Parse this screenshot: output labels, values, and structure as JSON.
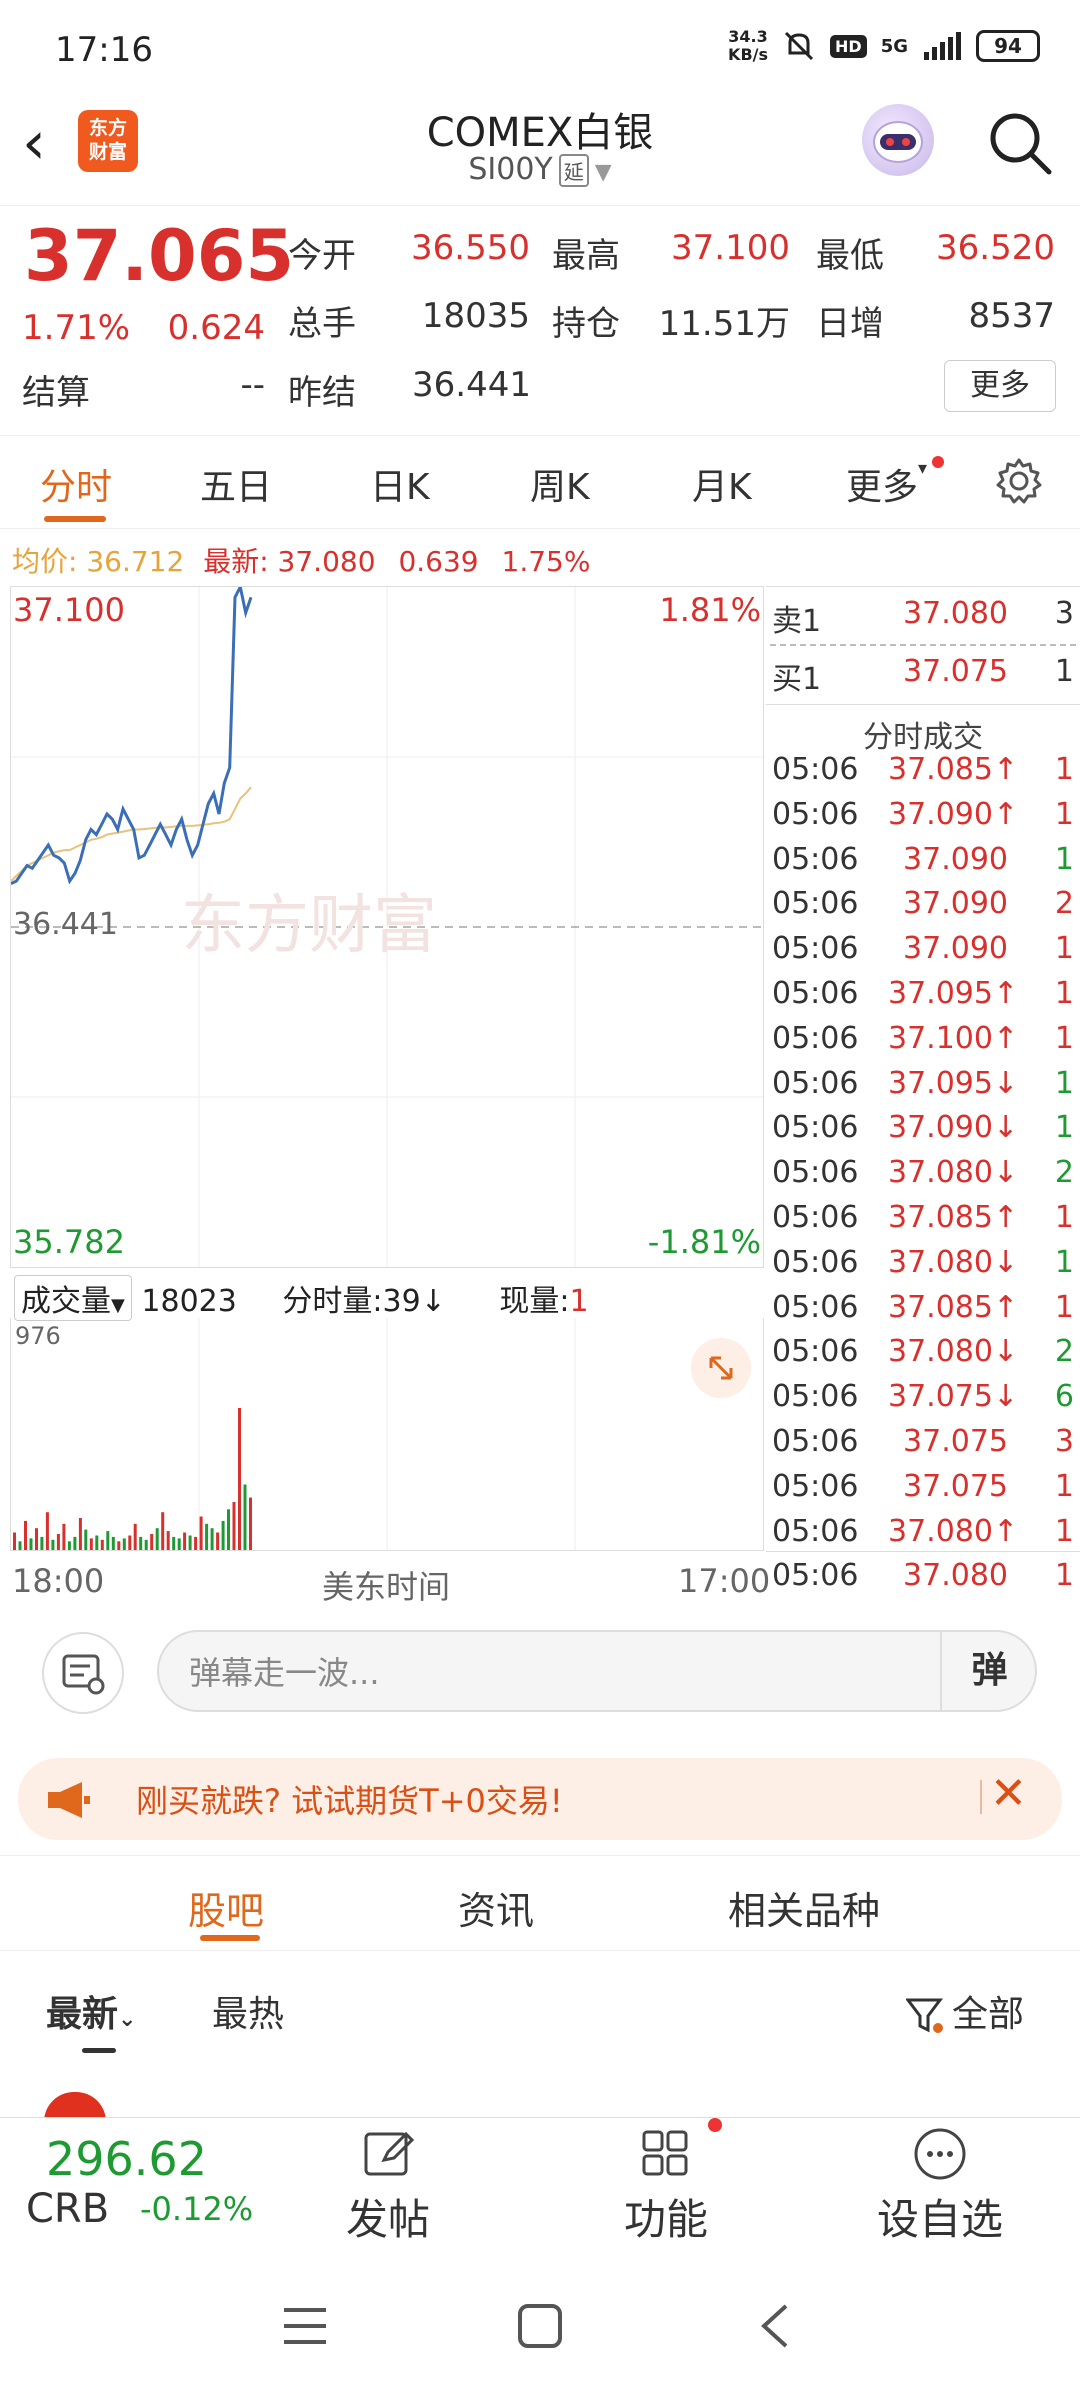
{
  "status": {
    "time": "17:16",
    "net_speed": "34.3",
    "net_unit": "KB/s",
    "hd": "HD",
    "signal": "5G",
    "battery": "94"
  },
  "nav": {
    "title": "COMEX白银",
    "code": "SI00Y",
    "delay_badge": "延"
  },
  "quote": {
    "price": "37.065",
    "change_pct": "1.71%",
    "change": "0.624",
    "settle_label": "结算",
    "settle_value": "--",
    "open_label": "今开",
    "open_value": "36.550",
    "high_label": "最高",
    "high_value": "37.100",
    "low_label": "最低",
    "low_value": "36.520",
    "vol_label": "总手",
    "vol_value": "18035",
    "oi_label": "持仓",
    "oi_value": "11.51万",
    "dayinc_label": "日增",
    "dayinc_value": "8537",
    "prev_label": "昨结",
    "prev_value": "36.441",
    "more_label": "更多"
  },
  "tabs": [
    "分时",
    "五日",
    "日K",
    "周K",
    "月K",
    "更多"
  ],
  "avg": {
    "avg_label": "均价: 36.712",
    "latest_label": "最新: 37.080",
    "chg": "0.639",
    "pct": "1.75%"
  },
  "chart_data": {
    "type": "line",
    "y_top": "37.100",
    "y_bottom": "35.782",
    "pct_top": "1.81%",
    "pct_bottom": "-1.81%",
    "prev_close": "36.441",
    "ylim": [
      35.782,
      37.1
    ],
    "xlabel_left": "18:00",
    "xlabel_mid": "美东时间",
    "xlabel_right": "17:00",
    "price": [
      36.525,
      36.53,
      36.545,
      36.56,
      36.555,
      36.57,
      36.585,
      36.6,
      36.58,
      36.575,
      36.565,
      36.53,
      36.545,
      36.57,
      36.61,
      36.63,
      36.62,
      36.64,
      36.66,
      36.65,
      36.63,
      36.67,
      36.65,
      36.63,
      36.575,
      36.58,
      36.6,
      36.62,
      36.64,
      36.62,
      36.6,
      36.63,
      36.65,
      36.61,
      36.58,
      36.6,
      36.64,
      36.68,
      36.7,
      36.66,
      36.72,
      36.75,
      37.08,
      37.1,
      37.05,
      37.08
    ],
    "average": [
      36.53,
      36.54,
      36.55,
      36.56,
      36.565,
      36.57,
      36.575,
      36.58,
      36.585,
      36.588,
      36.59,
      36.59,
      36.595,
      36.6,
      36.605,
      36.61,
      36.612,
      36.615,
      36.62,
      36.622,
      36.624,
      36.626,
      36.628,
      36.63,
      36.63,
      36.631,
      36.632,
      36.633,
      36.634,
      36.634,
      36.635,
      36.636,
      36.637,
      36.637,
      36.637,
      36.638,
      36.639,
      36.64,
      36.642,
      36.643,
      36.645,
      36.65,
      36.67,
      36.69,
      36.7,
      36.712
    ],
    "volume_max_label": "976",
    "volume": [
      120,
      60,
      200,
      80,
      150,
      90,
      260,
      70,
      110,
      180,
      60,
      90,
      220,
      140,
      80,
      100,
      70,
      130,
      90,
      60,
      80,
      100,
      180,
      90,
      70,
      110,
      150,
      260,
      130,
      90,
      80,
      120,
      100,
      90,
      230,
      180,
      150,
      120,
      200,
      280,
      330,
      976,
      450,
      360
    ],
    "volume_colors": [
      "r",
      "g",
      "r",
      "g",
      "r",
      "g",
      "r",
      "g",
      "r",
      "r",
      "g",
      "g",
      "r",
      "g",
      "r",
      "g",
      "r",
      "g",
      "g",
      "r",
      "g",
      "r",
      "r",
      "g",
      "g",
      "r",
      "g",
      "r",
      "r",
      "g",
      "g",
      "r",
      "g",
      "r",
      "r",
      "g",
      "g",
      "r",
      "g",
      "g",
      "r",
      "r",
      "g",
      "r"
    ]
  },
  "volbar": {
    "label": "成交量",
    "value": "18023",
    "tick_label": "分时量:39",
    "now_label": "现量:",
    "now_value": "1"
  },
  "orderbook": {
    "sell_label": "卖1",
    "sell_price": "37.080",
    "sell_vol": "3",
    "buy_label": "买1",
    "buy_price": "37.075",
    "buy_vol": "1"
  },
  "ticks_title": "分时成交",
  "ticks": [
    {
      "t": "05:06",
      "p": "37.085↑",
      "v": "1",
      "pc": "red",
      "vc": "red"
    },
    {
      "t": "05:06",
      "p": "37.090↑",
      "v": "1",
      "pc": "red",
      "vc": "red"
    },
    {
      "t": "05:06",
      "p": "37.090",
      "v": "1",
      "pc": "red",
      "vc": "green"
    },
    {
      "t": "05:06",
      "p": "37.090",
      "v": "2",
      "pc": "red",
      "vc": "red"
    },
    {
      "t": "05:06",
      "p": "37.090",
      "v": "1",
      "pc": "red",
      "vc": "red"
    },
    {
      "t": "05:06",
      "p": "37.095↑",
      "v": "1",
      "pc": "red",
      "vc": "red"
    },
    {
      "t": "05:06",
      "p": "37.100↑",
      "v": "1",
      "pc": "red",
      "vc": "red"
    },
    {
      "t": "05:06",
      "p": "37.095↓",
      "v": "1",
      "pc": "red",
      "vc": "green"
    },
    {
      "t": "05:06",
      "p": "37.090↓",
      "v": "1",
      "pc": "red",
      "vc": "green"
    },
    {
      "t": "05:06",
      "p": "37.080↓",
      "v": "2",
      "pc": "red",
      "vc": "green"
    },
    {
      "t": "05:06",
      "p": "37.085↑",
      "v": "1",
      "pc": "red",
      "vc": "red"
    },
    {
      "t": "05:06",
      "p": "37.080↓",
      "v": "1",
      "pc": "red",
      "vc": "green"
    },
    {
      "t": "05:06",
      "p": "37.085↑",
      "v": "1",
      "pc": "red",
      "vc": "red"
    },
    {
      "t": "05:06",
      "p": "37.080↓",
      "v": "2",
      "pc": "red",
      "vc": "green"
    },
    {
      "t": "05:06",
      "p": "37.075↓",
      "v": "6",
      "pc": "red",
      "vc": "green"
    },
    {
      "t": "05:06",
      "p": "37.075",
      "v": "3",
      "pc": "red",
      "vc": "red"
    },
    {
      "t": "05:06",
      "p": "37.075",
      "v": "1",
      "pc": "red",
      "vc": "red"
    },
    {
      "t": "05:06",
      "p": "37.080↑",
      "v": "1",
      "pc": "red",
      "vc": "red"
    },
    {
      "t": "05:06",
      "p": "37.080",
      "v": "1",
      "pc": "red",
      "vc": "red"
    }
  ],
  "danmu": {
    "placeholder": "弹幕走一波...",
    "button": "弹"
  },
  "ad": {
    "text": "刚买就跌? 试试期货T+0交易!"
  },
  "subtabs": [
    "股吧",
    "资讯",
    "相关品种"
  ],
  "sort": {
    "latest": "最新",
    "hot": "最热",
    "filter": "全部"
  },
  "bottom": {
    "price": "296.62",
    "symbol": "CRB",
    "change": "-0.12%",
    "post": "发帖",
    "func": "功能",
    "watch": "设自选"
  },
  "colors": {
    "red": "#d8302c",
    "green": "#1f9a33",
    "orange": "#e0681c",
    "line": "#3a6fb8",
    "avg": "#e8c27a"
  }
}
